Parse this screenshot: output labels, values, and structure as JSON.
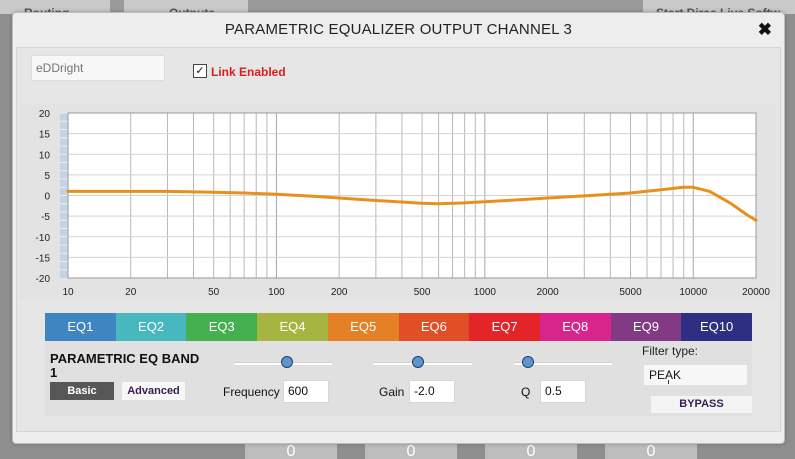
{
  "background": {
    "tabs": [
      "Routing",
      "Outputs",
      "Start Dirac Live Softw"
    ],
    "bottom_values": [
      "0",
      "0",
      "0",
      "0"
    ]
  },
  "dialog": {
    "title": "PARAMETRIC EQUALIZER OUTPUT CHANNEL 3",
    "close_label": "✖"
  },
  "channel": {
    "name_placeholder": "eDDright",
    "link_checked": true,
    "link_label": "Link Enabled"
  },
  "chart_data": {
    "type": "line",
    "x_scale": "log",
    "xlim": [
      10,
      20000
    ],
    "ylim": [
      -20,
      20
    ],
    "x_ticks": [
      "10",
      "20",
      "50",
      "100",
      "200",
      "500",
      "1000",
      "2000",
      "5000",
      "10000",
      "20000"
    ],
    "y_ticks": [
      "20",
      "15",
      "10",
      "5",
      "0",
      "-5",
      "-10",
      "-15",
      "-20"
    ],
    "grid": true,
    "line_color": "#e8911a",
    "x": [
      10,
      20,
      30,
      50,
      70,
      100,
      150,
      200,
      300,
      500,
      600,
      800,
      1000,
      1500,
      2000,
      3000,
      5000,
      7000,
      9000,
      10000,
      12000,
      15000,
      18000,
      20000
    ],
    "y": [
      1.0,
      1.0,
      1.0,
      0.8,
      0.6,
      0.3,
      -0.2,
      -0.6,
      -1.2,
      -1.9,
      -2.0,
      -1.8,
      -1.5,
      -1.0,
      -0.6,
      -0.1,
      0.6,
      1.4,
      2.0,
      2.0,
      1.0,
      -1.8,
      -4.6,
      -6.0
    ]
  },
  "eq_tabs": [
    {
      "label": "EQ1",
      "color": "#3f85c1"
    },
    {
      "label": "EQ2",
      "color": "#47b8c0"
    },
    {
      "label": "EQ3",
      "color": "#45b04f"
    },
    {
      "label": "EQ4",
      "color": "#a6b541"
    },
    {
      "label": "EQ5",
      "color": "#e48126"
    },
    {
      "label": "EQ6",
      "color": "#e14f26"
    },
    {
      "label": "EQ7",
      "color": "#e32429"
    },
    {
      "label": "EQ8",
      "color": "#d7258c"
    },
    {
      "label": "EQ9",
      "color": "#823a85"
    },
    {
      "label": "EQ10",
      "color": "#2e2f82"
    }
  ],
  "band": {
    "title": "PARAMETRIC EQ BAND 1",
    "basic_label": "Basic",
    "advanced_label": "Advanced",
    "frequency_label": "Frequency",
    "frequency_value": "600",
    "gain_label": "Gain",
    "gain_value": "-2.0",
    "q_label": "Q",
    "q_value": "0.5",
    "filter_type_label": "Filter type:",
    "filter_type_value": "PEAK",
    "bypass_label": "BYPASS"
  },
  "sliders": {
    "frequency_fraction": 0.54,
    "gain_fraction": 0.45,
    "q_fraction": 0.14
  },
  "colors": {
    "accent": "#5f95cf",
    "link_label": "#d81f1f"
  }
}
